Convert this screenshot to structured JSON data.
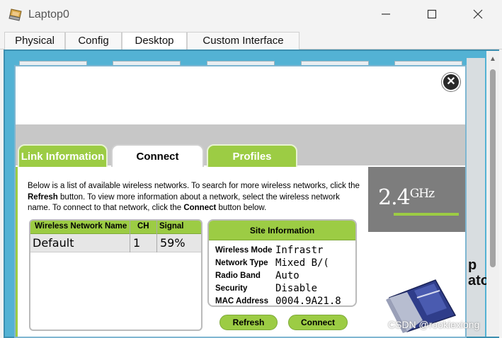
{
  "window": {
    "title": "Laptop0",
    "app_icon": "laptop-app-icon",
    "minimize_icon": "minimize-icon",
    "maximize_icon": "maximize-icon",
    "close_icon": "close-icon"
  },
  "tabs": [
    "Physical",
    "Config",
    "Desktop",
    "Custom Interface"
  ],
  "active_tab": "Desktop",
  "desktop": {
    "partial_text": "p\nato"
  },
  "dialog": {
    "close_icon": "close-circle-icon",
    "tabs": [
      "Link Information",
      "Connect",
      "Profiles"
    ],
    "active_tab": "Connect",
    "description": {
      "part1": "Below is a list of available wireless networks. To search for more wireless networks, click the ",
      "refresh": "Refresh",
      "part2": " button. To view more information about a network, select the wireless network name. To connect to that network, click the ",
      "connect": "Connect",
      "part3": " button below."
    },
    "network_table": {
      "headers": [
        "Wireless Network Name",
        "CH",
        "Signal"
      ],
      "rows": [
        {
          "name": "Default",
          "ch": "1",
          "signal": "59%"
        }
      ]
    },
    "site_info": {
      "title": "Site Information",
      "fields": [
        {
          "label": "Wireless Mode",
          "value": "Infrastr"
        },
        {
          "label": "Network Type",
          "value": "Mixed B/("
        },
        {
          "label": "Radio Band",
          "value": "Auto"
        },
        {
          "label": "Security",
          "value": "Disable"
        },
        {
          "label": "MAC Address",
          "value": "0004.9A21.8"
        }
      ]
    },
    "buttons": {
      "refresh": "Refresh",
      "connect": "Connect"
    },
    "band": {
      "value": "2.4",
      "unit": "GHz"
    }
  },
  "watermark": "CSDN @rookiexiong",
  "colors": {
    "accent_green": "#9ccc44",
    "desktop_blue": "#53b2d4",
    "side_gray": "#7d7d7d"
  }
}
